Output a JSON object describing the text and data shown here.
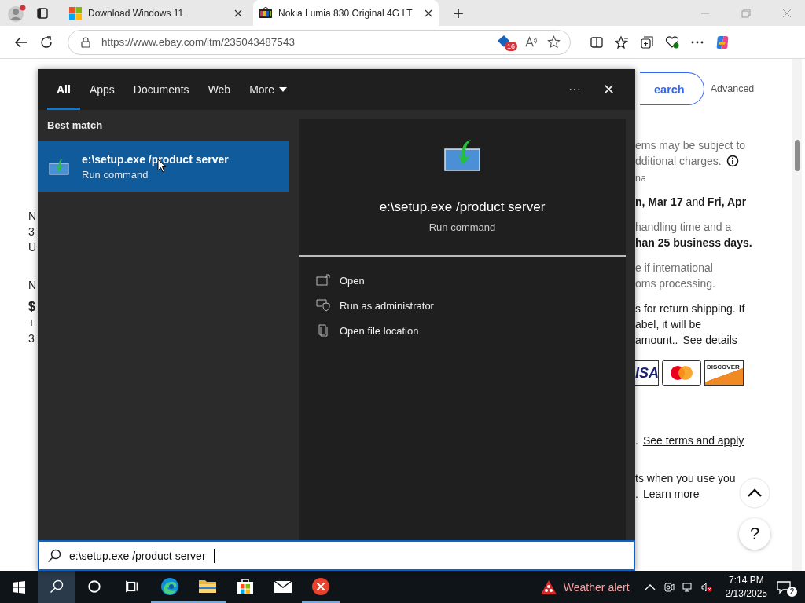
{
  "browser": {
    "tabs": [
      {
        "title": "Download Windows 11",
        "selected": false,
        "kind": "windows"
      },
      {
        "title": "Nokia Lumia 830 Original 4G LT",
        "selected": true,
        "kind": "shop"
      }
    ],
    "new_tab": "+",
    "url": "https://www.ebay.com/itm/235043487543",
    "tracker_badge": "16"
  },
  "page": {
    "search_button": "earch",
    "advanced": "Advanced",
    "left_fragments": [
      {
        "text": "N",
        "bold": false
      },
      {
        "text": "3",
        "bold": false
      },
      {
        "text": "U",
        "bold": false
      },
      {
        "text": "N",
        "bold": false
      },
      {
        "text": "$",
        "bold": true
      },
      {
        "text": "+",
        "bold": false
      },
      {
        "text": "3",
        "bold": false
      }
    ],
    "right_groups": [
      {
        "kind": "text",
        "lines": [
          {
            "text": "ems may be subject to",
            "muted": true,
            "bold": false,
            "info": false
          },
          {
            "text": "dditional charges.",
            "muted": true,
            "bold": false,
            "info": true
          },
          {
            "text": "na",
            "muted": true,
            "bold": false,
            "info": false
          }
        ]
      },
      {
        "kind": "text",
        "lines": [
          {
            "text": "**n, Mar 17** and **Fri, Apr**",
            "muted": false,
            "bold": false,
            "info": false
          }
        ]
      },
      {
        "kind": "text",
        "lines": [
          {
            "text": "handling time and a",
            "muted": true,
            "bold": false,
            "info": false
          },
          {
            "text": "han 25 business days.",
            "muted": false,
            "bold": true,
            "info": false
          }
        ]
      },
      {
        "kind": "text",
        "lines": [
          {
            "text": "e if international",
            "muted": true,
            "bold": false,
            "info": false
          },
          {
            "text": "oms processing.",
            "muted": true,
            "bold": false,
            "info": false
          }
        ]
      },
      {
        "kind": "text",
        "lines": [
          {
            "text": "s for return shipping. If",
            "muted": false,
            "bold": false,
            "info": false
          },
          {
            "text": "abel, it will be",
            "muted": false,
            "bold": false,
            "info": false
          },
          {
            "text": "amount..",
            "muted": false,
            "bold": false,
            "info": false,
            "link": "See details"
          }
        ]
      },
      {
        "kind": "cards",
        "cards": [
          {
            "kind": "visa",
            "label": "ISA"
          },
          {
            "kind": "mastercard"
          },
          {
            "kind": "discover",
            "label": "DISCOVER"
          }
        ]
      },
      {
        "kind": "text",
        "lines": [
          {
            "text": ".",
            "muted": false,
            "bold": false,
            "info": false,
            "link": "See terms and apply"
          }
        ]
      },
      {
        "kind": "text",
        "lines": [
          {
            "text": "ts when you use you",
            "muted": false,
            "bold": false,
            "info": false
          },
          {
            "text": ".",
            "muted": false,
            "bold": false,
            "info": false,
            "link": "Learn more"
          }
        ]
      }
    ],
    "help_button": "?"
  },
  "search_panel": {
    "tabs": [
      {
        "label": "All",
        "selected": true,
        "kind": "tab"
      },
      {
        "label": "Apps",
        "selected": false,
        "kind": "tab"
      },
      {
        "label": "Documents",
        "selected": false,
        "kind": "tab"
      },
      {
        "label": "Web",
        "selected": false,
        "kind": "tab"
      },
      {
        "label": "More",
        "selected": false,
        "kind": "dropdown"
      }
    ],
    "more_options": "···",
    "close": "✕",
    "best_match_heading": "Best match",
    "results": [
      {
        "title": "e:\\setup.exe /product server",
        "subtitle": "Run command",
        "selected": true
      }
    ],
    "preview": {
      "title": "e:\\setup.exe /product server",
      "subtitle": "Run command",
      "actions": [
        {
          "label": "Open",
          "kind": "open"
        },
        {
          "label": "Run as administrator",
          "kind": "admin"
        },
        {
          "label": "Open file location",
          "kind": "folder"
        }
      ]
    },
    "query": "e:\\setup.exe /product server"
  },
  "taskbar": {
    "apps": [
      {
        "kind": "cortana",
        "running": false
      },
      {
        "kind": "taskview",
        "running": false
      },
      {
        "kind": "edge",
        "running": true
      },
      {
        "kind": "folder",
        "running": true
      },
      {
        "kind": "store",
        "running": false
      },
      {
        "kind": "mail",
        "running": false
      },
      {
        "kind": "error",
        "running": true
      }
    ],
    "weather_alert": "Weather alert",
    "time": "7:14 PM",
    "date": "2/13/2025",
    "notifications": "2"
  }
}
